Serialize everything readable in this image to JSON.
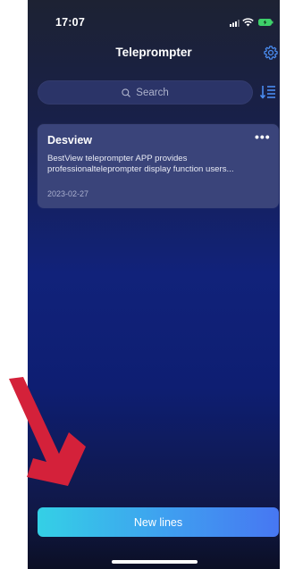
{
  "status_bar": {
    "time": "17:07"
  },
  "header": {
    "title": "Teleprompter",
    "settings_icon": "gear-icon"
  },
  "search": {
    "placeholder": "Search",
    "sort_icon": "sort-icon"
  },
  "scripts": [
    {
      "title": "Desview",
      "more_label": "•••",
      "desc_line1": "BestView teleprompter APP provides",
      "desc_line2": "professionalteleprompter display function users...",
      "date": "2023-02-27"
    }
  ],
  "footer": {
    "new_lines_label": "New lines"
  },
  "colors": {
    "accent_start": "#34d0e6",
    "accent_end": "#4777f2",
    "annotation_arrow": "#d4213a",
    "icon_accent": "#4a8cf0"
  }
}
